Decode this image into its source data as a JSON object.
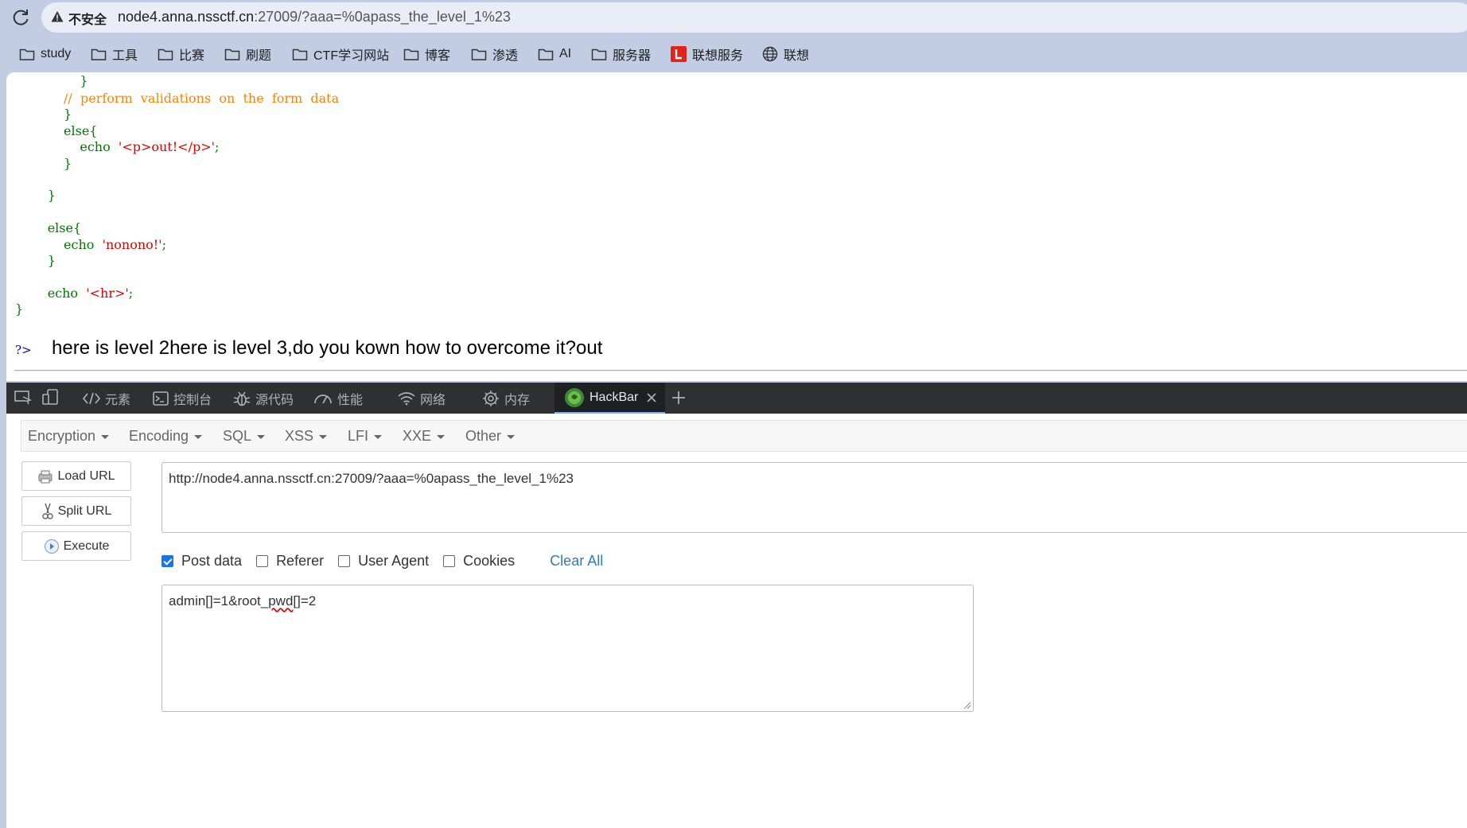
{
  "browser": {
    "insecure_label": "不安全",
    "url_host": "node4.anna.nssctf.cn",
    "url_rest": ":27009/?aaa=%0apass_the_level_1%23"
  },
  "bookmarks": [
    {
      "label": "study",
      "icon": "folder-icon"
    },
    {
      "label": "工具",
      "icon": "folder-icon"
    },
    {
      "label": "比赛",
      "icon": "folder-icon"
    },
    {
      "label": "刷题",
      "icon": "folder-icon"
    },
    {
      "label": "CTF学习网站",
      "icon": "folder-icon"
    },
    {
      "label": "博客",
      "icon": "folder-icon"
    },
    {
      "label": "渗透",
      "icon": "folder-icon"
    },
    {
      "label": "AI",
      "icon": "folder-icon"
    },
    {
      "label": "服务器",
      "icon": "folder-icon"
    },
    {
      "label": "联想服务",
      "icon": "lenovo-icon"
    },
    {
      "label": "联想",
      "icon": "globe-icon"
    }
  ],
  "page": {
    "code_lines": [
      {
        "indent": "                ",
        "text": "}",
        "cls": "k"
      },
      {
        "indent": "            ",
        "text": "//  perform  validations  on  the  form  data",
        "cls": "c"
      },
      {
        "indent": "            ",
        "text": "}",
        "cls": "k"
      },
      {
        "indent": "            ",
        "text": "else{",
        "cls": "k"
      },
      {
        "indent": "                ",
        "text": "echo  ",
        "cls": "k",
        "str": "'<p>out!</p>'",
        "tail": ";"
      },
      {
        "indent": "            ",
        "text": "}",
        "cls": "k"
      },
      {
        "indent": "",
        "text": "",
        "cls": "k"
      },
      {
        "indent": "        ",
        "text": "}",
        "cls": "k"
      },
      {
        "indent": "",
        "text": "",
        "cls": "k"
      },
      {
        "indent": "        ",
        "text": "else{",
        "cls": "k"
      },
      {
        "indent": "            ",
        "text": "echo  ",
        "cls": "k",
        "str": "'nonono!'",
        "tail": ";"
      },
      {
        "indent": "        ",
        "text": "}",
        "cls": "k"
      },
      {
        "indent": "",
        "text": "",
        "cls": "k"
      },
      {
        "indent": "        ",
        "text": "echo  ",
        "cls": "k",
        "str": "'<hr>'",
        "tail": ";"
      },
      {
        "indent": "",
        "text": "}",
        "cls": "k"
      }
    ],
    "php_close": "?>",
    "output_text": "here is level 2here is level 3,do you kown how to overcome it?out"
  },
  "devtools": {
    "tabs": [
      {
        "label": "元素",
        "icon": "code-icon"
      },
      {
        "label": "控制台",
        "icon": "console-icon"
      },
      {
        "label": "源代码",
        "icon": "bug-icon"
      },
      {
        "label": "性能",
        "icon": "gauge-icon"
      },
      {
        "label": "网络",
        "icon": "wifi-icon"
      },
      {
        "label": "内存",
        "icon": "chip-icon"
      }
    ],
    "active_tab": "HackBar",
    "accent": "#7cacf8"
  },
  "hackbar": {
    "menu": [
      "Encryption",
      "Encoding",
      "SQL",
      "XSS",
      "LFI",
      "XXE",
      "Other"
    ],
    "buttons": {
      "load": "Load URL",
      "split": "Split URL",
      "execute": "Execute"
    },
    "url_value": "http://node4.anna.nssctf.cn:27009/?aaa=%0apass_the_level_1%23",
    "options": [
      {
        "label": "Post data",
        "checked": true
      },
      {
        "label": "Referer",
        "checked": false
      },
      {
        "label": "User Agent",
        "checked": false
      },
      {
        "label": "Cookies",
        "checked": false
      }
    ],
    "clear_all": "Clear All",
    "post_prefix": "admin[]=1&root_",
    "post_squiggle": "pwd",
    "post_suffix": "[]=2",
    "link_color": "#337ab7"
  }
}
